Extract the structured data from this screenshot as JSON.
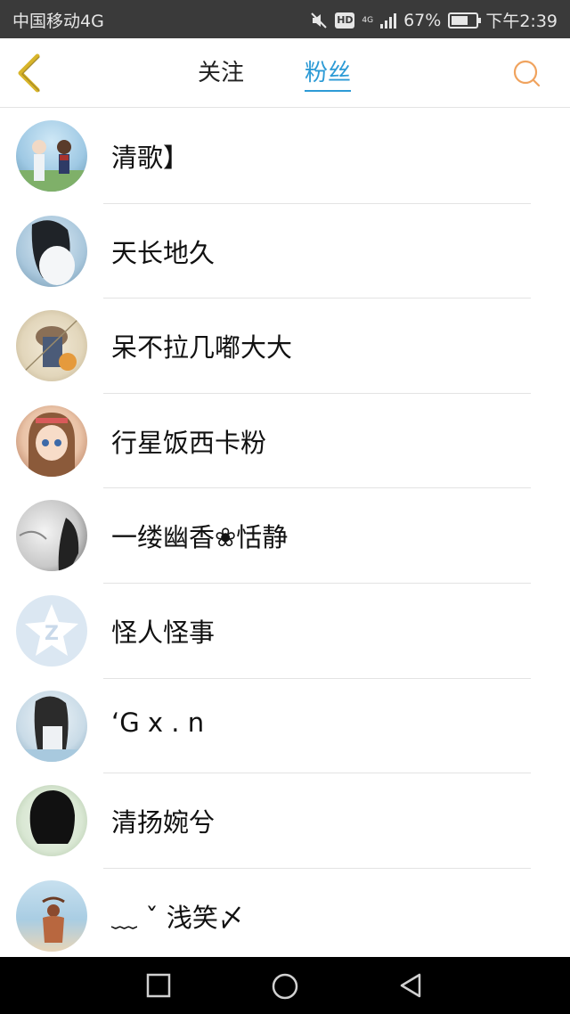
{
  "status_bar": {
    "carrier": "中国移动4G",
    "hd": "HD",
    "network": "4G",
    "battery": "67%",
    "battery_level": 0.67,
    "time": "下午2:39"
  },
  "header": {
    "back_icon": "chevron-left-icon",
    "tabs": [
      {
        "label": "关注",
        "active": false
      },
      {
        "label": "粉丝",
        "active": true
      }
    ],
    "search_icon": "search-icon",
    "accent_color": "#2d9bd6",
    "back_color": "#d8b52a",
    "search_color": "#f0a35e"
  },
  "fans": [
    {
      "name": "清歌】"
    },
    {
      "name": "天长地久"
    },
    {
      "name": "呆不拉几嘟大大"
    },
    {
      "name": "行星饭西卡粉"
    },
    {
      "name": "一缕幽香❀恬静"
    },
    {
      "name": "怪人怪事"
    },
    {
      "name": "‘G x . n"
    },
    {
      "name": "清扬婉兮"
    },
    {
      "name": "﹏ ˇ 浅笑〆"
    }
  ],
  "system_nav": {
    "recent_icon": "square-icon",
    "home_icon": "circle-icon",
    "back_icon": "triangle-back-icon"
  }
}
